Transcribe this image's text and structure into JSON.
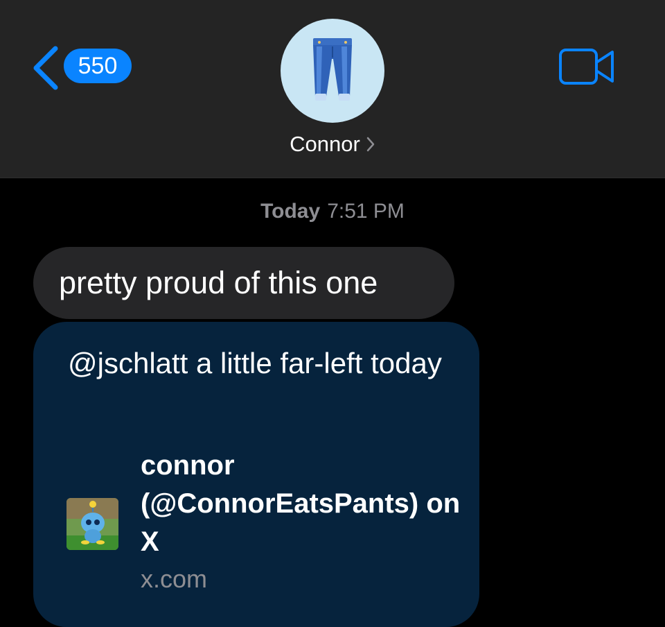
{
  "header": {
    "back_count": "550",
    "contact_name": "Connor",
    "icons": {
      "back": "chevron-left-icon",
      "video": "video-camera-icon",
      "avatar": "jeans-emoji-icon",
      "name_chevron": "chevron-right-icon"
    }
  },
  "conversation": {
    "timestamp_day": "Today",
    "timestamp_time": "7:51 PM",
    "messages": [
      {
        "text": "pretty proud of this one"
      }
    ],
    "link_preview": {
      "text": "@jschlatt a little far-left today",
      "title": "connor (@ConnorEatsPants) on X",
      "domain": "x.com"
    }
  },
  "colors": {
    "accent": "#0a84ff",
    "header_bg": "#242424",
    "incoming_bubble": "#262628",
    "link_card_bg": "#06233d",
    "secondary_text": "#8e8e93"
  }
}
